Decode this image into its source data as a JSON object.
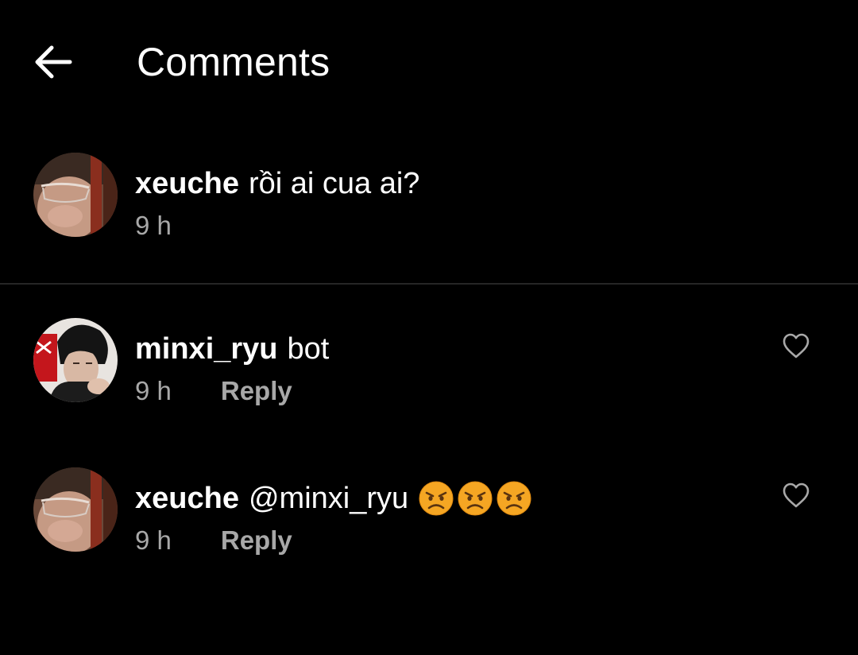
{
  "header": {
    "title": "Comments",
    "back_icon": "back-arrow-icon"
  },
  "caption": {
    "username": "xeuche",
    "text": "rồi ai cua ai?",
    "time": "9 h"
  },
  "comments": [
    {
      "username": "minxi_ryu",
      "text": "bot",
      "time": "9 h",
      "reply_label": "Reply",
      "like_icon": "heart-outline-icon"
    },
    {
      "username": "xeuche",
      "text": "@minxi_ryu",
      "emojis": [
        "angry-face-icon",
        "angry-face-icon",
        "angry-face-icon"
      ],
      "time": "9 h",
      "reply_label": "Reply",
      "like_icon": "heart-outline-icon"
    }
  ],
  "colors": {
    "background": "#000000",
    "text_primary": "#ffffff",
    "text_secondary": "#a8a8a8",
    "divider": "#262626"
  }
}
